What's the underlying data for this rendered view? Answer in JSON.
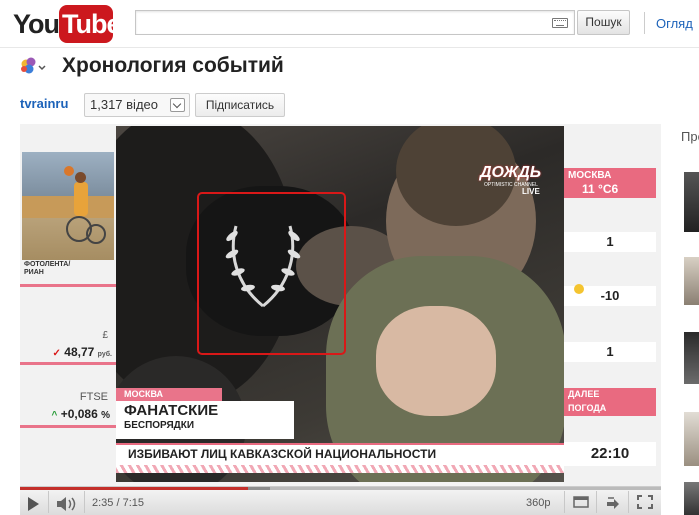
{
  "header": {
    "logo_you": "You",
    "logo_tube": "Tube",
    "search_placeholder": "",
    "search_button": "Пошук",
    "browse_link": "Огляд"
  },
  "video": {
    "title": "Хронология событий"
  },
  "channel": {
    "name": "tvrainru",
    "video_count": "1,317 відео",
    "subscribe_label": "Підписатись"
  },
  "sidebar": {
    "label": "Про"
  },
  "player_overlay": {
    "photo_caption_line1": "ФОТОЛЕНТА/",
    "photo_caption_line2": "РИАН",
    "left_ticker": {
      "currency_label": "£",
      "currency_value": "48,77",
      "currency_unit": "руб.",
      "index_label": "FTSE",
      "index_value": "+0,086",
      "index_unit": "%"
    },
    "right_ticker": {
      "city": "МОСКВА",
      "temp": "11 °С6",
      "value1": "1",
      "value2": "-10",
      "value3": "1",
      "next_label": "ДАЛЕЕ",
      "next_item": "ПОГОДА",
      "time": "22:10"
    },
    "location_tag": "МОСКВА",
    "headline_main": "ФАНАТСКИЕ",
    "headline_sub": "БЕСПОРЯДКИ",
    "crawl_text": "ИЗБИВАЮТ ЛИЦ КАВКАЗСКОЙ НАЦИОНАЛЬНОСТИ",
    "bug_text": "ДОЖДЬ",
    "bug_sub": "OPTIMISTIC CHANNEL",
    "bug_live": "LIVE"
  },
  "controls": {
    "current_time": "2:35",
    "duration": "7:15",
    "time_display": "2:35 / 7:15",
    "quality": "360p",
    "progress_fraction": 0.356,
    "buffer_fraction": 0.39
  },
  "colors": {
    "brand_red": "#cc181e",
    "link_blue": "#1c62b9",
    "highlight_red": "#d91818",
    "ticker_pink": "#e96a80"
  }
}
